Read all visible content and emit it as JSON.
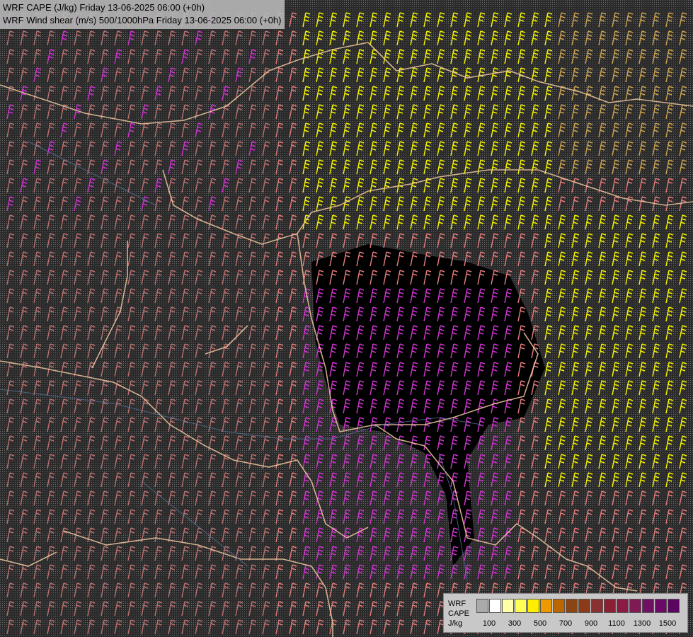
{
  "header": {
    "title_line_1": "WRF CAPE (J/kg) Friday 13-06-2025 06:00 (+0h)",
    "title_line_2": "WRF Wind shear (m/s) 500/1000hPa Friday 13-06-2025 06:00 (+0h)"
  },
  "legend": {
    "label_line_1": "WRF",
    "label_line_2": "CAPE",
    "label_line_3": "J/kg",
    "swatch_colors": [
      "#aaaaaa",
      "#ffffff",
      "#ffffaa",
      "#ffff55",
      "#ffee00",
      "#ee9900",
      "#bb6600",
      "#8b4513",
      "#8b3a1a",
      "#8b3030",
      "#8b2035",
      "#8b1a45",
      "#801a55",
      "#701060",
      "#6a0a66",
      "#5a0560"
    ],
    "tick_labels": [
      "100",
      "300",
      "500",
      "700",
      "900",
      "1100",
      "1300",
      "1500"
    ]
  },
  "map": {
    "barb_colors": {
      "weak": "#b86e6e",
      "moderate": "#e07a7a",
      "strong": "#f0f000",
      "shear_magenta": "#cc33cc",
      "tan": "#c8a050"
    },
    "border_color": "#f0c8a0",
    "river_color": "#5a7aa8",
    "cape_fill_color": "#000000"
  }
}
